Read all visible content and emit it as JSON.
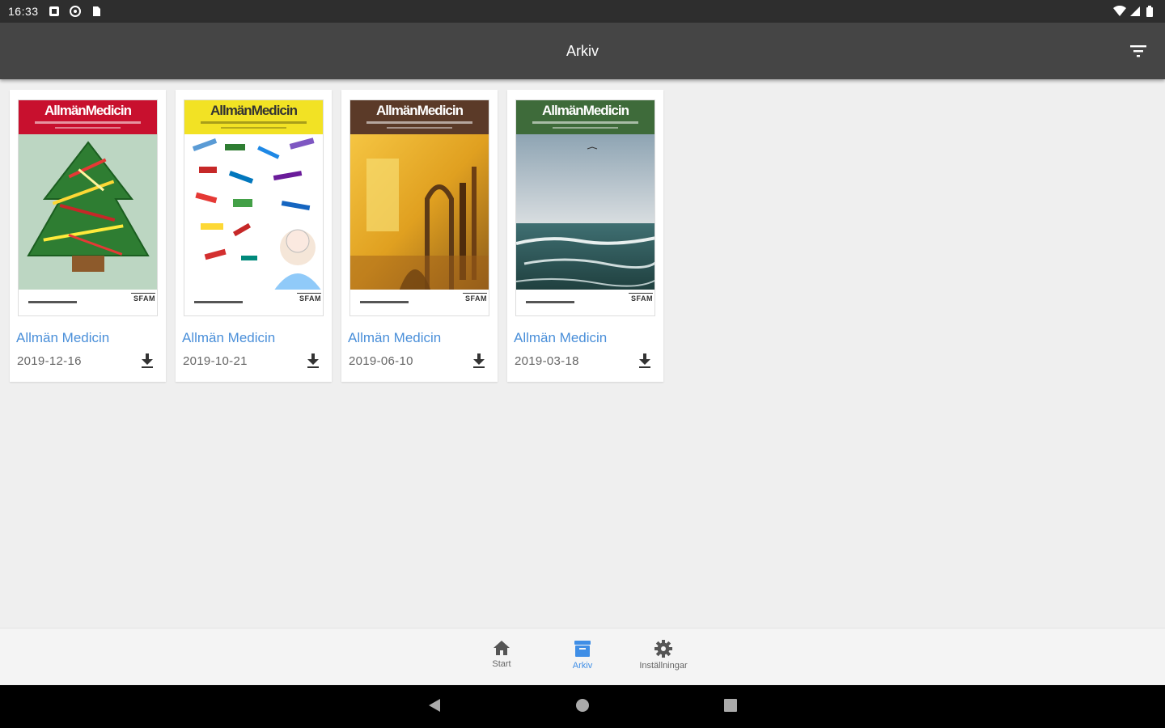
{
  "status_bar": {
    "time": "16:33"
  },
  "app_bar": {
    "title": "Arkiv",
    "filter_icon": "filter-icon"
  },
  "issues": [
    {
      "title": "Allmän Medicin",
      "date": "2019-12-16",
      "cover_logo": "AllmänMedicin",
      "cover_color": "#c8102e",
      "cover_brand": "SFAM"
    },
    {
      "title": "Allmän Medicin",
      "date": "2019-10-21",
      "cover_logo": "AllmänMedicin",
      "cover_color": "#f2e224",
      "cover_brand": "SFAM"
    },
    {
      "title": "Allmän Medicin",
      "date": "2019-06-10",
      "cover_logo": "AllmänMedicin",
      "cover_color": "#5b3a28",
      "cover_brand": "SFAM"
    },
    {
      "title": "Allmän Medicin",
      "date": "2019-03-18",
      "cover_logo": "AllmänMedicin",
      "cover_color": "#3e6b3a",
      "cover_brand": "SFAM"
    }
  ],
  "bottom_nav": {
    "items": [
      {
        "label": "Start",
        "icon": "home-icon",
        "active": false
      },
      {
        "label": "Arkiv",
        "icon": "archive-icon",
        "active": true
      },
      {
        "label": "Inställningar",
        "icon": "settings-icon",
        "active": false
      }
    ]
  },
  "colors": {
    "accent": "#3f8ee6",
    "app_bar": "#454545",
    "status_bar": "#2e2e2e",
    "link": "#4a8fd9"
  }
}
